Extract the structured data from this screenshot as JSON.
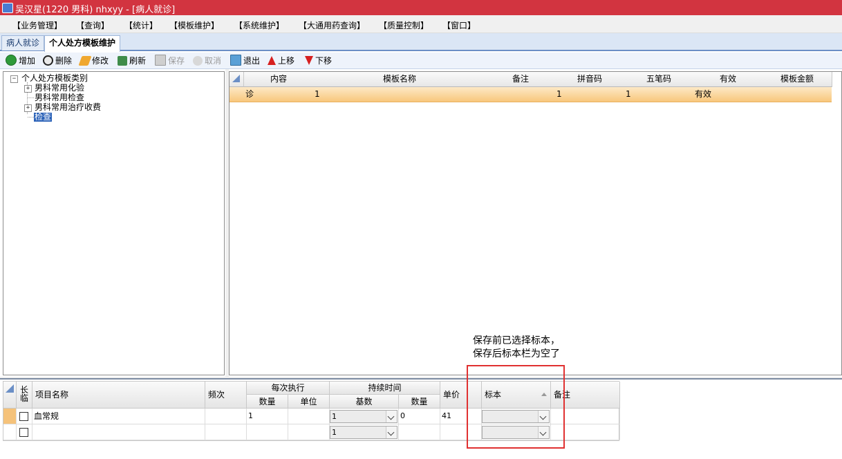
{
  "window": {
    "title": "吴汉星(1220 男科) nhxyy - [病人就诊]",
    "title_color": "#d23440"
  },
  "menu": [
    "【业务管理】",
    "【查询】",
    "【统计】",
    "【模板维护】",
    "【系统维护】",
    "【大通用药查询】",
    "【质量控制】",
    "【窗口】"
  ],
  "tabs": [
    {
      "label": "病人就诊",
      "active": false
    },
    {
      "label": "个人处方模板维护",
      "active": true
    }
  ],
  "toolbar": {
    "add": "增加",
    "delete": "删除",
    "modify": "修改",
    "refresh": "刷新",
    "save": "保存",
    "cancel": "取消",
    "exit": "退出",
    "move_up": "上移",
    "move_down": "下移"
  },
  "tree": {
    "root": "个人处方模板类别",
    "children": [
      "男科常用化验",
      "男科常用检查",
      "男科常用治疗收费",
      "检查"
    ],
    "selected": "检查"
  },
  "template_grid": {
    "headers": [
      "内容",
      "模板名称",
      "备注",
      "拼音码",
      "五笔码",
      "有效",
      "模板金额"
    ],
    "rows": [
      {
        "content": "诊",
        "name": "1",
        "remark": "",
        "pinyin": "1",
        "wubi": "1",
        "valid": "有效",
        "amount": ""
      }
    ]
  },
  "item_grid": {
    "headers": {
      "long_term": "长\n临",
      "item_name": "项目名称",
      "frequency": "频次",
      "per_exec": "每次执行",
      "quantity": "数量",
      "unit": "单位",
      "duration": "持续时间",
      "base": "基数",
      "duration_qty": "数量",
      "price": "单价",
      "specimen": "标本",
      "remark": "备注"
    },
    "rows": [
      {
        "checked": false,
        "item_name": "血常规",
        "frequency": "",
        "quantity": "1",
        "unit": "",
        "base": "1",
        "duration_qty": "0",
        "price": "41",
        "specimen": ""
      },
      {
        "checked": false,
        "item_name": "",
        "frequency": "",
        "quantity": "",
        "unit": "",
        "base": "1",
        "duration_qty": "",
        "price": "",
        "specimen": ""
      }
    ]
  },
  "annotation": {
    "line1": "保存前已选择标本，",
    "line2": "保存后标本栏为空了",
    "box_color": "#e03030"
  }
}
